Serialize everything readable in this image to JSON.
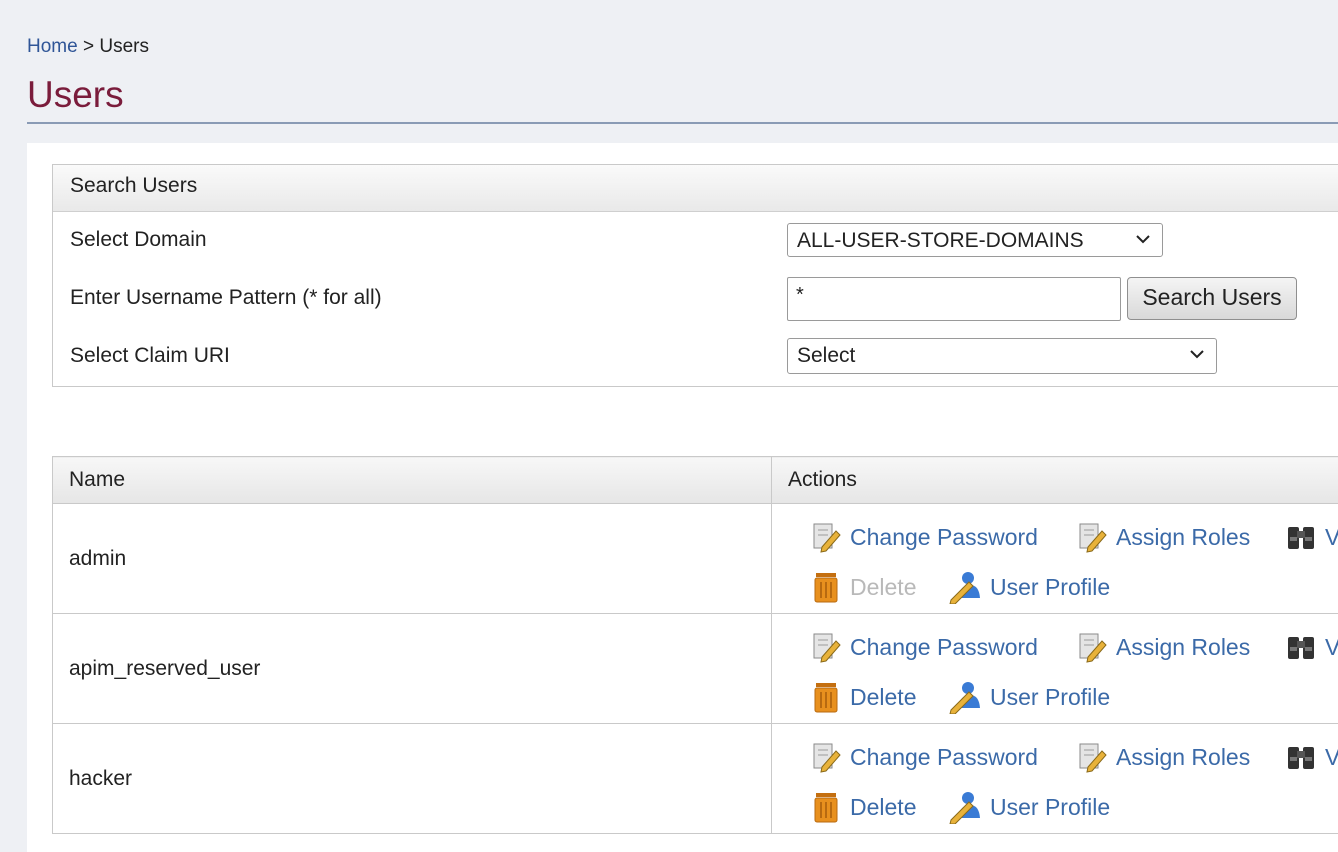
{
  "breadcrumb": {
    "home": "Home",
    "separator": ">",
    "current": "Users"
  },
  "page_title": "Users",
  "search": {
    "header": "Search Users",
    "domain_label": "Select Domain",
    "domain_value": "ALL-USER-STORE-DOMAINS",
    "pattern_label": "Enter Username Pattern (* for all)",
    "pattern_value": "*",
    "search_button": "Search Users",
    "claim_label": "Select Claim URI",
    "claim_value": "Select"
  },
  "table": {
    "headers": {
      "name": "Name",
      "actions": "Actions"
    },
    "rows": [
      {
        "name": "admin",
        "delete_enabled": false
      },
      {
        "name": "apim_reserved_user",
        "delete_enabled": true
      },
      {
        "name": "hacker",
        "delete_enabled": true
      }
    ],
    "actions": {
      "change_password": "Change Password",
      "assign_roles": "Assign Roles",
      "view_roles": "V",
      "delete": "Delete",
      "user_profile": "User Profile"
    }
  },
  "icons": {
    "change_password": "edit-document-icon",
    "assign_roles": "edit-document-icon",
    "view_roles": "binoculars-icon",
    "delete": "trash-icon",
    "user_profile": "user-edit-icon"
  },
  "colors": {
    "title": "#7a1c3b",
    "link": "#3b6aa8",
    "disabled": "#b9b9b9",
    "trash": "#e8901e"
  }
}
